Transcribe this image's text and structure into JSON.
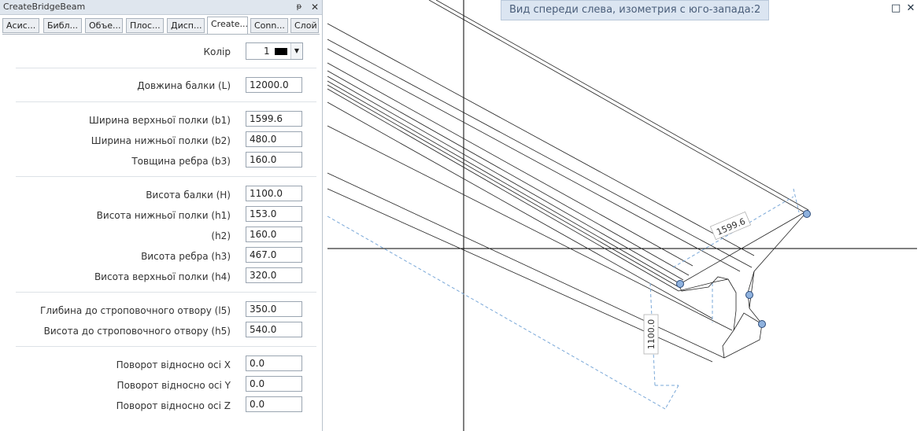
{
  "panel": {
    "title": "CreateBridgeBeam",
    "pin_glyph": "📌",
    "close_glyph": "✕",
    "tabs": [
      "Асис...",
      "Библ...",
      "Объе...",
      "Плос...",
      "Дисп...",
      "Create...",
      "Conn...",
      "Слой"
    ],
    "active_tab": 5
  },
  "color": {
    "label": "Колір",
    "value": "1"
  },
  "fields": [
    {
      "label": "Довжина балки (L)",
      "value": "12000.0"
    },
    {
      "label": "Ширина верхньої полки (b1)",
      "value": "1599.6"
    },
    {
      "label": "Ширина нижньої полки (b2)",
      "value": "480.0"
    },
    {
      "label": "Товщина ребра (b3)",
      "value": "160.0"
    },
    {
      "label": "Висота балки (H)",
      "value": "1100.0"
    },
    {
      "label": "Висота нижньої полки (h1)",
      "value": "153.0"
    },
    {
      "label": "(h2)",
      "value": "160.0"
    },
    {
      "label": "Висота ребра (h3)",
      "value": "467.0"
    },
    {
      "label": "Висота верхньої полки (h4)",
      "value": "320.0"
    },
    {
      "label": "Глибина до строповочного отвору (l5)",
      "value": "350.0"
    },
    {
      "label": "Висота до строповочного отвору (h5)",
      "value": "540.0"
    },
    {
      "label": "Поворот відносно осі X",
      "value": "0.0"
    },
    {
      "label": "Поворот відносно осі Y",
      "value": "0.0"
    },
    {
      "label": "Поворот відносно осі Z",
      "value": "0.0"
    }
  ],
  "viewport": {
    "view_name": "Вид спереди слева, изометрия с юго-запада:2",
    "dimension_width": "1599.6",
    "dimension_height": "1100.0",
    "restore_glyph": "□",
    "close_glyph": "✕"
  }
}
